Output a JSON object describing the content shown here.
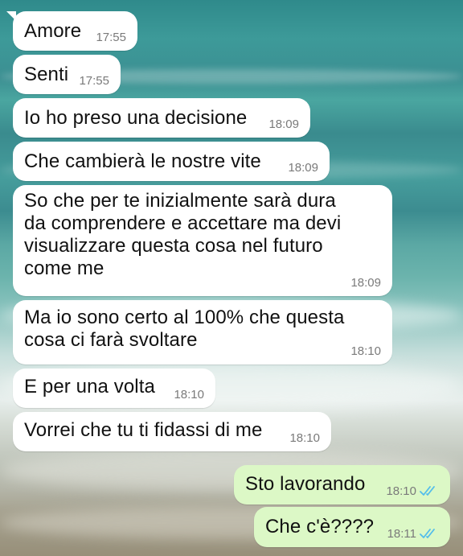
{
  "chat": {
    "incoming": [
      {
        "text": "Amore",
        "time": "17:55"
      },
      {
        "text": "Senti",
        "time": "17:55"
      },
      {
        "text": "Io ho preso una decisione",
        "time": "18:09"
      },
      {
        "text": "Che cambierà le nostre vite",
        "time": "18:09"
      },
      {
        "text": "So che per te inizialmente sarà dura\nda comprendere e accettare ma devi\nvisualizzare questa cosa nel futuro\ncome me",
        "time": "18:09"
      },
      {
        "text": "Ma io sono certo al 100% che questa\ncosa ci farà svoltare",
        "time": "18:10"
      },
      {
        "text": "E per una volta",
        "time": "18:10"
      },
      {
        "text": "Vorrei che tu ti fidassi di me",
        "time": "18:10"
      }
    ],
    "outgoing": [
      {
        "text": "Sto lavorando",
        "time": "18:10",
        "status": "read"
      },
      {
        "text": "Che c'è????",
        "time": "18:11",
        "status": "read"
      }
    ]
  },
  "colors": {
    "incoming_bubble": "#ffffff",
    "outgoing_bubble": "#dcf8c6",
    "read_ticks": "#53bdeb",
    "timestamp": "#7a7a7a"
  },
  "icons": {
    "read_status": "double-check-icon"
  }
}
